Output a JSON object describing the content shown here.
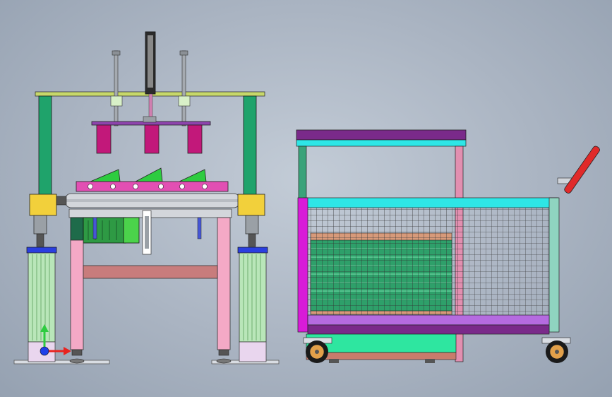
{
  "viewport": {
    "background_top": "#c3ccd7",
    "background_edge": "#95a1b1"
  },
  "models": [
    {
      "name": "press-machine",
      "colors": [
        "#7fbf7f",
        "#c7d86a",
        "#8e44ad",
        "#c2187a",
        "#1fa36b",
        "#e24fb3",
        "#f4a9c6",
        "#c87c7c",
        "#2e9a44",
        "#9aa0a6"
      ]
    },
    {
      "name": "mesh-cart",
      "colors": [
        "#7a2a8a",
        "#2ee6e6",
        "#3aa37a",
        "#e28fb0",
        "#2ea06a",
        "#b56be0",
        "#e2a04a",
        "#2aa87a",
        "#8fd4c0"
      ]
    }
  ],
  "triad": {
    "x_color": "#e8231f",
    "y_color": "#2ecc40",
    "z_color": "#1f3fe8"
  }
}
